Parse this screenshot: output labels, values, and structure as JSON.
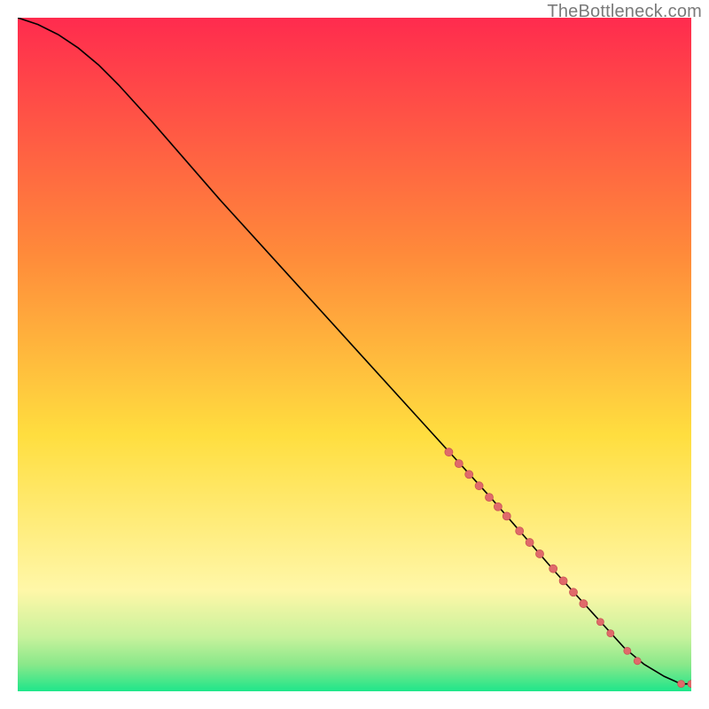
{
  "watermark_text": "TheBottleneck.com",
  "colors": {
    "top": "#ff2b4e",
    "mid_upper": "#ff8a3a",
    "mid": "#ffde3f",
    "mid_lower": "#fff7a8",
    "band1": "#c7f29c",
    "band2": "#8ae88a",
    "bottom": "#1ee68a",
    "curve": "#000000",
    "point_fill": "#e06a6a",
    "point_stroke": "#c95555"
  },
  "chart_data": {
    "type": "line",
    "title": "",
    "xlabel": "",
    "ylabel": "",
    "xlim": [
      0,
      100
    ],
    "ylim": [
      0,
      100
    ],
    "curve": {
      "x": [
        0,
        3,
        6,
        9,
        12,
        15,
        20,
        30,
        40,
        50,
        60,
        70,
        80,
        90,
        93,
        96,
        98,
        99,
        100
      ],
      "y": [
        100,
        99,
        97.5,
        95.5,
        93,
        90,
        84.5,
        73,
        62,
        51,
        40,
        29,
        17.5,
        6.5,
        4,
        2.2,
        1.3,
        1.1,
        1.1
      ]
    },
    "points": [
      {
        "x": 64.0,
        "y": 35.5,
        "r": 4.5
      },
      {
        "x": 65.5,
        "y": 33.8,
        "r": 4.5
      },
      {
        "x": 67.0,
        "y": 32.2,
        "r": 4.5
      },
      {
        "x": 68.5,
        "y": 30.5,
        "r": 4.5
      },
      {
        "x": 70.0,
        "y": 28.8,
        "r": 4.5
      },
      {
        "x": 71.3,
        "y": 27.4,
        "r": 4.5
      },
      {
        "x": 72.6,
        "y": 26.0,
        "r": 4.5
      },
      {
        "x": 74.5,
        "y": 23.8,
        "r": 4.5
      },
      {
        "x": 76.0,
        "y": 22.1,
        "r": 4.5
      },
      {
        "x": 77.5,
        "y": 20.4,
        "r": 4.5
      },
      {
        "x": 79.5,
        "y": 18.2,
        "r": 4.5
      },
      {
        "x": 81.0,
        "y": 16.4,
        "r": 4.5
      },
      {
        "x": 82.5,
        "y": 14.7,
        "r": 4.5
      },
      {
        "x": 84.0,
        "y": 13.0,
        "r": 4.5
      },
      {
        "x": 86.5,
        "y": 10.3,
        "r": 4.0
      },
      {
        "x": 88.0,
        "y": 8.6,
        "r": 4.0
      },
      {
        "x": 90.5,
        "y": 6.0,
        "r": 4.0
      },
      {
        "x": 92.0,
        "y": 4.5,
        "r": 4.0
      },
      {
        "x": 98.5,
        "y": 1.1,
        "r": 4.0
      },
      {
        "x": 100.0,
        "y": 1.1,
        "r": 4.0
      }
    ]
  }
}
